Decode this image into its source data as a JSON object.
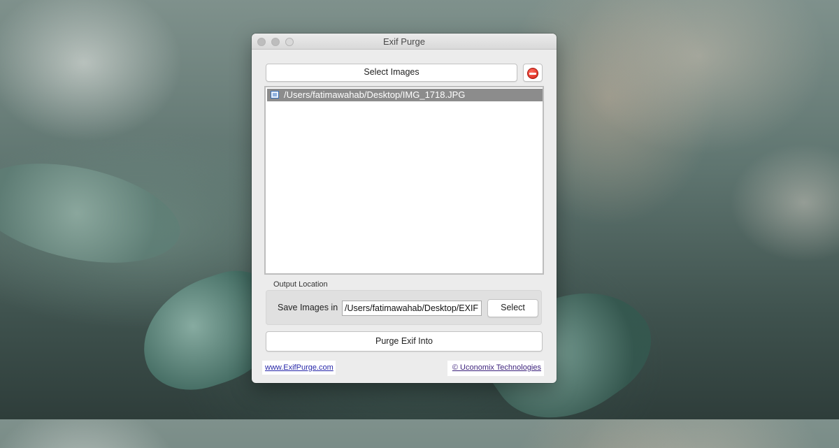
{
  "window": {
    "title": "Exif Purge"
  },
  "toolbar": {
    "select_images_label": "Select Images",
    "remove_icon": "remove-icon"
  },
  "file_list": {
    "items": [
      {
        "path": "/Users/fatimawahab/Desktop/IMG_1718.JPG",
        "icon": "image-file-icon",
        "selected": true
      }
    ]
  },
  "output": {
    "group_label": "Output Location",
    "save_label": "Save Images in",
    "path_value": "/Users/fatimawahab/Desktop/EXIF",
    "select_label": "Select"
  },
  "actions": {
    "purge_label": "Purge Exif Into"
  },
  "footer": {
    "site_link": "www.ExifPurge.com",
    "company_link": "© Uconomix Technologies"
  },
  "colors": {
    "selection": "#8c8c8c",
    "remove": "#d41f12",
    "link": "#2525a8"
  }
}
